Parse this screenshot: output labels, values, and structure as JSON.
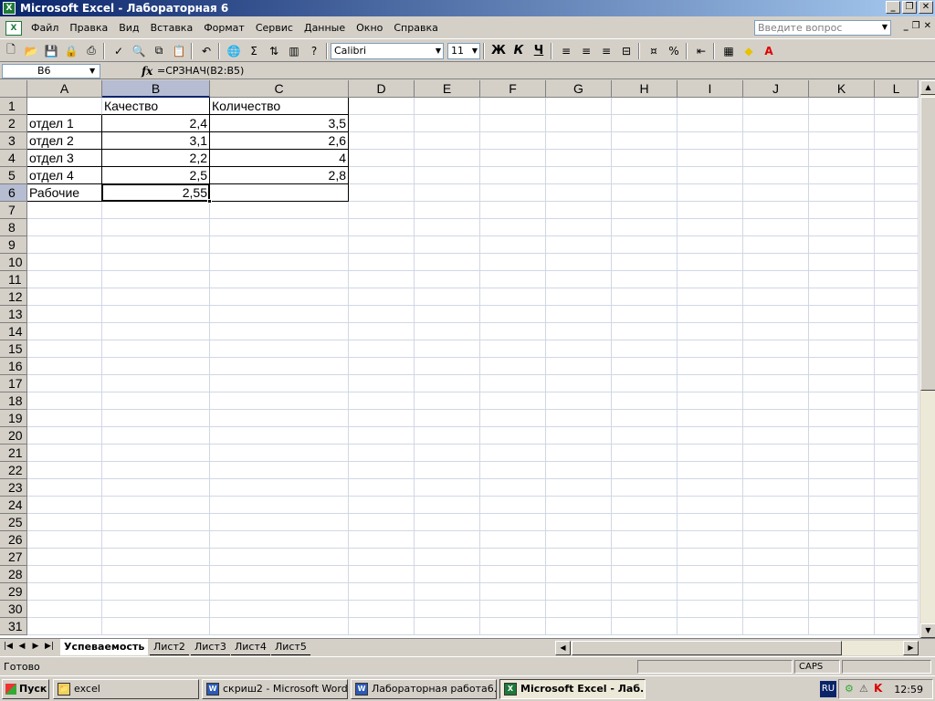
{
  "window": {
    "title": "Microsoft Excel - Лабораторная 6",
    "minimize": "_",
    "restore": "❐",
    "close": "✕"
  },
  "menu": {
    "items": [
      "Файл",
      "Правка",
      "Вид",
      "Вставка",
      "Формат",
      "Сервис",
      "Данные",
      "Окно",
      "Справка"
    ],
    "help_placeholder": "Введите вопрос"
  },
  "toolbar": {
    "font_name": "Calibri",
    "font_size": "11",
    "bold": "Ж",
    "italic": "К",
    "underline": "Ч",
    "percent": "%",
    "sum": "Σ"
  },
  "formula_bar": {
    "name_box": "B6",
    "fx": "fx",
    "formula": "=СРЗНАЧ(B2:B5)"
  },
  "columns": [
    "A",
    "B",
    "C",
    "D",
    "E",
    "F",
    "G",
    "H",
    "I",
    "J",
    "K",
    "L"
  ],
  "rows": [
    "1",
    "2",
    "3",
    "4",
    "5",
    "6",
    "7",
    "8",
    "9",
    "10",
    "11",
    "12",
    "13",
    "14",
    "15",
    "16",
    "17",
    "18",
    "19",
    "20",
    "21",
    "22",
    "23",
    "24",
    "25",
    "26",
    "27",
    "28",
    "29",
    "30",
    "31"
  ],
  "selected_cell": "B6",
  "cells": {
    "B1": "Качество",
    "C1": "Количество",
    "A2": "отдел 1",
    "B2": "2,4",
    "C2": "3,5",
    "A3": "отдел 2",
    "B3": "3,1",
    "C3": "2,6",
    "A4": "отдел 3",
    "B4": "2,2",
    "C4": "4",
    "A5": "отдел 4",
    "B5": "2,5",
    "C5": "2,8",
    "A6": "Рабочие",
    "B6": "2,55"
  },
  "sheets": {
    "tabs": [
      "Успеваемость",
      "Лист2",
      "Лист3",
      "Лист4",
      "Лист5"
    ],
    "active": "Успеваемость"
  },
  "status": {
    "ready": "Готово",
    "caps": "CAPS"
  },
  "taskbar": {
    "start": "Пуск",
    "tasks": [
      {
        "label": "excel",
        "icon": "folder-icon"
      },
      {
        "label": "скриш2 - Microsoft Word",
        "icon": "word-icon"
      },
      {
        "label": "Лабораторная работа6...",
        "icon": "word-icon"
      },
      {
        "label": "Microsoft Excel - Лаб...",
        "icon": "excel-icon"
      }
    ],
    "lang": "RU",
    "clock": "12:59"
  }
}
